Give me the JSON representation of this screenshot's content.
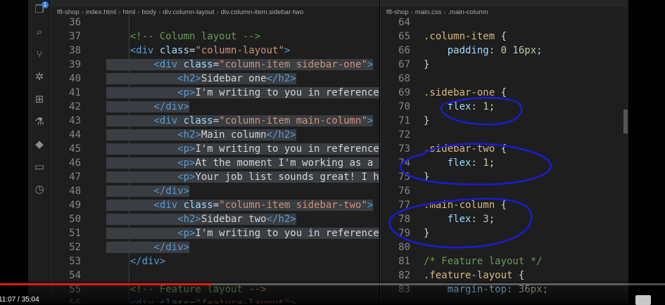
{
  "activity_bar": {
    "badge": "1",
    "icons": [
      "explorer-icon",
      "search-icon",
      "source-control-icon",
      "debug-icon",
      "extensions-icon",
      "testing-icon",
      "docker-icon",
      "remote-icon",
      "timeline-icon"
    ]
  },
  "left_editor": {
    "breadcrumb": [
      "f8-shop",
      "index.html",
      "html",
      "body",
      "div.column-layout",
      "div.column-item.sidebar-two"
    ],
    "lines": [
      {
        "n": "36",
        "parts": []
      },
      {
        "n": "37",
        "parts": [
          [
            "c-comment",
            "    <!-- Column layout -->"
          ]
        ]
      },
      {
        "n": "38",
        "parts": [
          [
            "c-tag",
            "    <div "
          ],
          [
            "c-attr",
            "class"
          ],
          [
            "c-txt",
            "="
          ],
          [
            "c-str",
            "\"column-layout\""
          ],
          [
            "c-tag",
            ">"
          ]
        ]
      },
      {
        "n": "39",
        "parts": [
          [
            "c-tag",
            "        <div "
          ],
          [
            "c-attr",
            "class"
          ],
          [
            "c-txt",
            "="
          ],
          [
            "c-str",
            "\"column-item sidebar-one\""
          ],
          [
            "c-tag",
            ">"
          ]
        ]
      },
      {
        "n": "40",
        "parts": [
          [
            "c-tag",
            "            <h2>"
          ],
          [
            "c-txt",
            "Sidebar one"
          ],
          [
            "c-tag",
            "</h2>"
          ]
        ]
      },
      {
        "n": "41",
        "parts": [
          [
            "c-tag",
            "            <p>"
          ],
          [
            "c-txt",
            "I'm writing to you in reference to the"
          ]
        ]
      },
      {
        "n": "42",
        "parts": [
          [
            "c-tag",
            "        </div>"
          ]
        ]
      },
      {
        "n": "43",
        "parts": [
          [
            "c-tag",
            "        <div "
          ],
          [
            "c-attr",
            "class"
          ],
          [
            "c-txt",
            "="
          ],
          [
            "c-str",
            "\"column-item main-column\""
          ],
          [
            "c-tag",
            ">"
          ]
        ]
      },
      {
        "n": "44",
        "parts": [
          [
            "c-tag",
            "            <h2>"
          ],
          [
            "c-txt",
            "Main column"
          ],
          [
            "c-tag",
            "</h2>"
          ]
        ]
      },
      {
        "n": "45",
        "parts": [
          [
            "c-tag",
            "            <p>"
          ],
          [
            "c-txt",
            "I'm writing to you in reference to the"
          ]
        ]
      },
      {
        "n": "46",
        "parts": [
          [
            "c-tag",
            "            <p>"
          ],
          [
            "c-txt",
            "At the moment I'm working as a Sample"
          ]
        ]
      },
      {
        "n": "47",
        "parts": [
          [
            "c-tag",
            "            <p>"
          ],
          [
            "c-txt",
            "Your job list sounds great! I hope tha"
          ]
        ]
      },
      {
        "n": "48",
        "parts": [
          [
            "c-tag",
            "        </div>"
          ]
        ]
      },
      {
        "n": "49",
        "parts": [
          [
            "c-tag",
            "        <div "
          ],
          [
            "c-attr",
            "class"
          ],
          [
            "c-txt",
            "="
          ],
          [
            "c-str",
            "\"column-item sidebar-two\""
          ],
          [
            "c-tag",
            ">"
          ]
        ]
      },
      {
        "n": "50",
        "parts": [
          [
            "c-tag",
            "            <h2>"
          ],
          [
            "c-txt",
            "Sidebar two"
          ],
          [
            "c-tag",
            "</h2>"
          ]
        ]
      },
      {
        "n": "51",
        "parts": [
          [
            "c-tag",
            "            <p>"
          ],
          [
            "c-txt",
            "I'm writing to you in reference to the"
          ]
        ]
      },
      {
        "n": "52",
        "parts": [
          [
            "c-tag",
            "        </div>"
          ]
        ]
      },
      {
        "n": "53",
        "parts": [
          [
            "c-tag",
            "    </div>"
          ]
        ]
      },
      {
        "n": "54",
        "parts": []
      },
      {
        "n": "55",
        "parts": [
          [
            "c-comment",
            "    <!-- Feature layout -->"
          ]
        ]
      },
      {
        "n": "56",
        "parts": [
          [
            "c-tag",
            "    <div "
          ],
          [
            "c-attr",
            "class"
          ],
          [
            "c-txt",
            "="
          ],
          [
            "c-str",
            "\"feature-layout\""
          ],
          [
            "c-tag",
            ">"
          ]
        ]
      }
    ]
  },
  "right_editor": {
    "breadcrumb": [
      "f8-shop",
      "main.css",
      ".main-column"
    ],
    "lines": [
      {
        "n": "64",
        "parts": []
      },
      {
        "n": "65",
        "parts": [
          [
            "c-sel",
            ".column-item"
          ],
          [
            "c-txt",
            " {"
          ]
        ]
      },
      {
        "n": "66",
        "parts": [
          [
            "c-prop",
            "    padding"
          ],
          [
            "c-txt",
            ": "
          ],
          [
            "c-num",
            "0 16px"
          ],
          [
            "c-txt",
            ";"
          ]
        ]
      },
      {
        "n": "67",
        "parts": [
          [
            "c-txt",
            "}"
          ]
        ]
      },
      {
        "n": "68",
        "parts": []
      },
      {
        "n": "69",
        "parts": [
          [
            "c-sel",
            ".sidebar-one"
          ],
          [
            "c-txt",
            " {"
          ]
        ]
      },
      {
        "n": "70",
        "parts": [
          [
            "c-prop",
            "    flex"
          ],
          [
            "c-txt",
            ": "
          ],
          [
            "c-num",
            "1"
          ],
          [
            "c-txt",
            ";"
          ]
        ]
      },
      {
        "n": "71",
        "parts": [
          [
            "c-txt",
            "}"
          ]
        ]
      },
      {
        "n": "72",
        "parts": []
      },
      {
        "n": "73",
        "parts": [
          [
            "c-sel",
            ".sidebar-two"
          ],
          [
            "c-txt",
            " {"
          ]
        ]
      },
      {
        "n": "74",
        "parts": [
          [
            "c-prop",
            "    flex"
          ],
          [
            "c-txt",
            ": "
          ],
          [
            "c-num",
            "1"
          ],
          [
            "c-txt",
            ";"
          ]
        ]
      },
      {
        "n": "75",
        "parts": [
          [
            "c-txt",
            "}"
          ]
        ]
      },
      {
        "n": "76",
        "parts": []
      },
      {
        "n": "77",
        "parts": [
          [
            "c-sel",
            ".main-column"
          ],
          [
            "c-txt",
            " {"
          ]
        ]
      },
      {
        "n": "78",
        "parts": [
          [
            "c-prop",
            "    flex"
          ],
          [
            "c-txt",
            ": "
          ],
          [
            "c-num",
            "3"
          ],
          [
            "c-txt",
            ";"
          ]
        ]
      },
      {
        "n": "79",
        "parts": [
          [
            "c-txt",
            "}"
          ]
        ]
      },
      {
        "n": "80",
        "parts": []
      },
      {
        "n": "81",
        "parts": [
          [
            "c-comment",
            "/* Feature layout */"
          ]
        ]
      },
      {
        "n": "82",
        "parts": [
          [
            "c-sel",
            ".feature-layout"
          ],
          [
            "c-txt",
            " {"
          ]
        ]
      },
      {
        "n": "83",
        "parts": [
          [
            "c-prop",
            "    margin-top"
          ],
          [
            "c-txt",
            ": "
          ],
          [
            "c-num",
            "36px"
          ],
          [
            "c-txt",
            ";"
          ]
        ]
      }
    ]
  },
  "player": {
    "time": "11:07 / 35:04",
    "progress": 0.317
  }
}
